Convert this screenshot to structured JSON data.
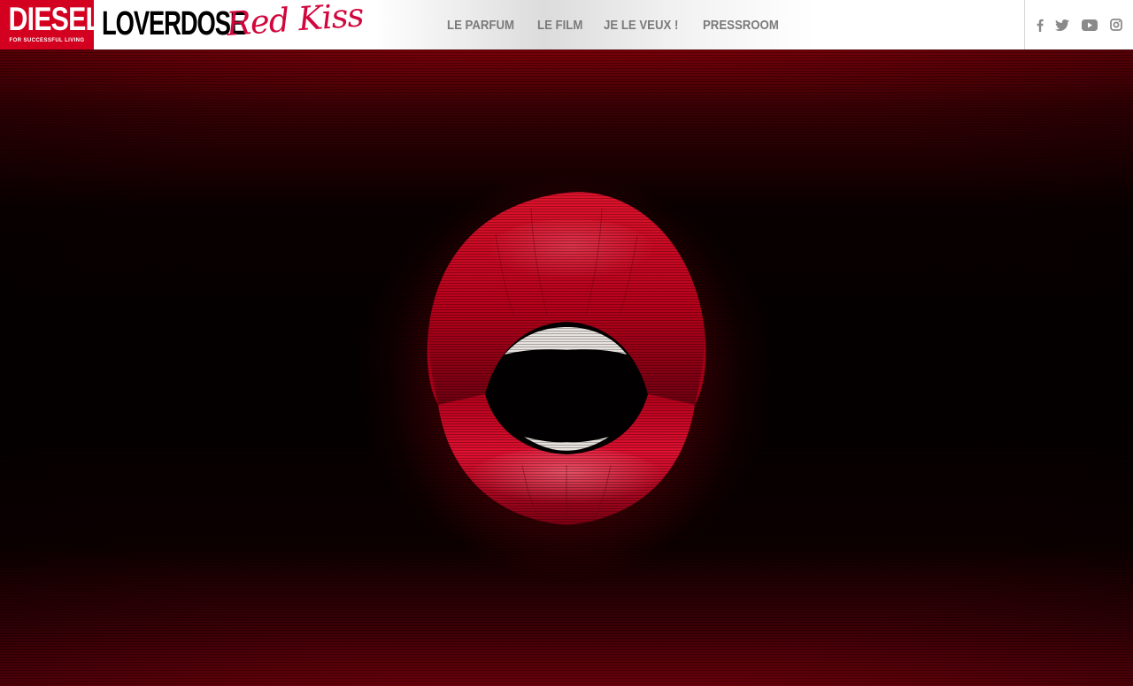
{
  "header": {
    "diesel_logo": {
      "word": "DIESEL",
      "tagline": "FOR SUCCESSFUL LIVING"
    },
    "brand": {
      "name": "LOVERDOSE",
      "script": "Red Kiss"
    }
  },
  "nav": {
    "items": [
      {
        "label": "LE PARFUM"
      },
      {
        "label": "LE FILM"
      },
      {
        "label": "JE LE VEUX !"
      },
      {
        "label": "PRESSROOM"
      }
    ]
  },
  "social": {
    "icons": [
      "facebook-icon",
      "twitter-icon",
      "youtube-icon",
      "instagram-icon"
    ]
  },
  "colors": {
    "diesel_red": "#d3001f",
    "script_pink": "#d1063d",
    "nav_gray": "#7a7a7a",
    "lip_red": "#c4001c"
  }
}
